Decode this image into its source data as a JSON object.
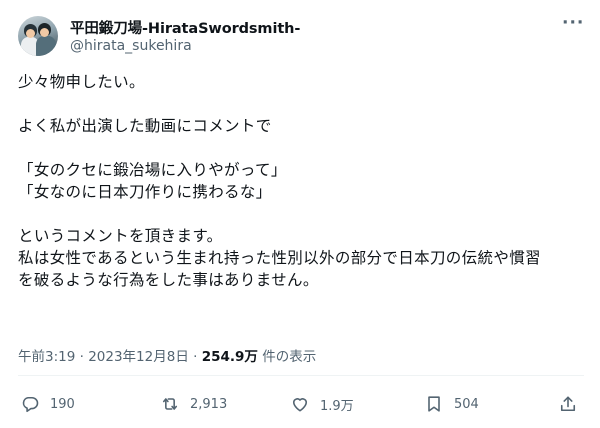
{
  "author": {
    "display_name": "平田鍛刀場-HirataSwordsmith-",
    "handle": "@hirata_sukehira"
  },
  "more_label": "···",
  "tweet": {
    "paragraphs": [
      [
        "少々物申したい。"
      ],
      [
        "よく私が出演した動画にコメントで"
      ],
      [
        "「女のクセに鍛冶場に入りやがって」",
        "「女なのに日本刀作りに携わるな」"
      ],
      [
        "というコメントを頂きます。",
        "私は女性であるという生まれ持った性別以外の部分で日本刀の伝統や慣習",
        "を破るような行為をした事はありません。"
      ]
    ]
  },
  "meta": {
    "time": "午前3:19",
    "separator": " · ",
    "date": "2023年12月8日",
    "views": "254.9万",
    "views_suffix": " 件の表示"
  },
  "actions": {
    "reply_count": "190",
    "retweet_count": "2,913",
    "like_count": "1.9万",
    "bookmark_count": "504"
  },
  "icons": {
    "reply": "reply-icon",
    "retweet": "retweet-icon",
    "like": "heart-icon",
    "bookmark": "bookmark-icon",
    "share": "share-icon"
  },
  "colors": {
    "text": "#0f1419",
    "secondary": "#536471",
    "divider": "#eff3f4"
  }
}
